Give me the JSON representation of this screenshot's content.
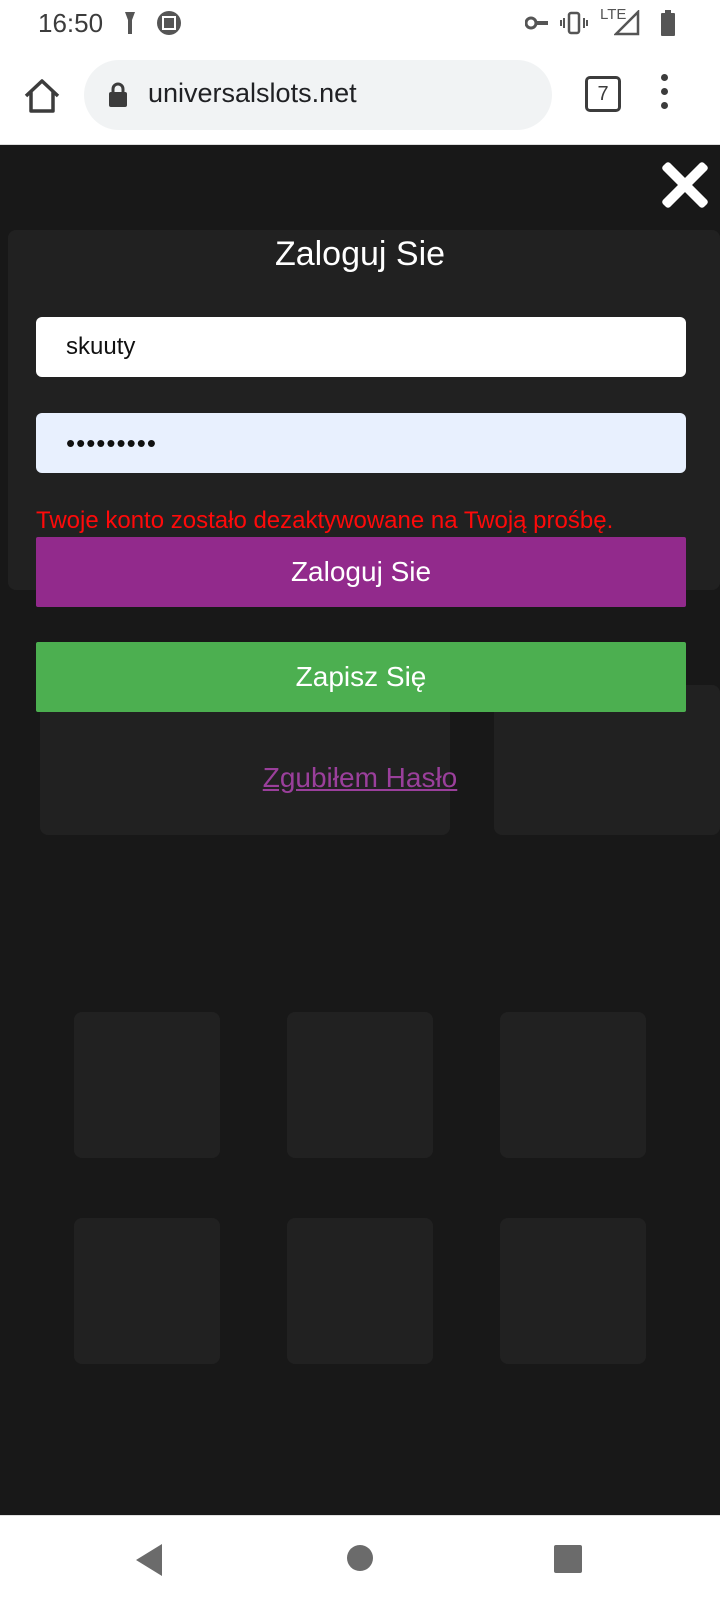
{
  "status_bar": {
    "time": "16:50",
    "network": "LTE",
    "icons": [
      "flashlight-icon",
      "app-badge-icon",
      "key-icon",
      "vibrate-icon",
      "signal-icon",
      "battery-icon"
    ]
  },
  "browser": {
    "url": "universalslots.net",
    "tab_count": "7",
    "icons": [
      "home-icon",
      "lock-icon",
      "tabs-icon",
      "more-vert-icon"
    ]
  },
  "modal": {
    "title": "Zaloguj Sie",
    "username_value": "skuuty",
    "password_value": "•••••••••",
    "error_message": "Twoje konto zostało dezaktywowane na Twoją prośbę.",
    "login_button": "Zaloguj Sie",
    "register_button": "Zapisz Się",
    "forgot_link": "Zgubiłem Hasło"
  },
  "colors": {
    "login_button": "#922a8c",
    "register_button": "#4caf50",
    "error_text": "#ff0a0a",
    "forgot_link": "#9a3f9b",
    "overlay": "#262626"
  },
  "navigation": {
    "icons": [
      "back-icon",
      "home-circle-icon",
      "recents-icon"
    ]
  }
}
